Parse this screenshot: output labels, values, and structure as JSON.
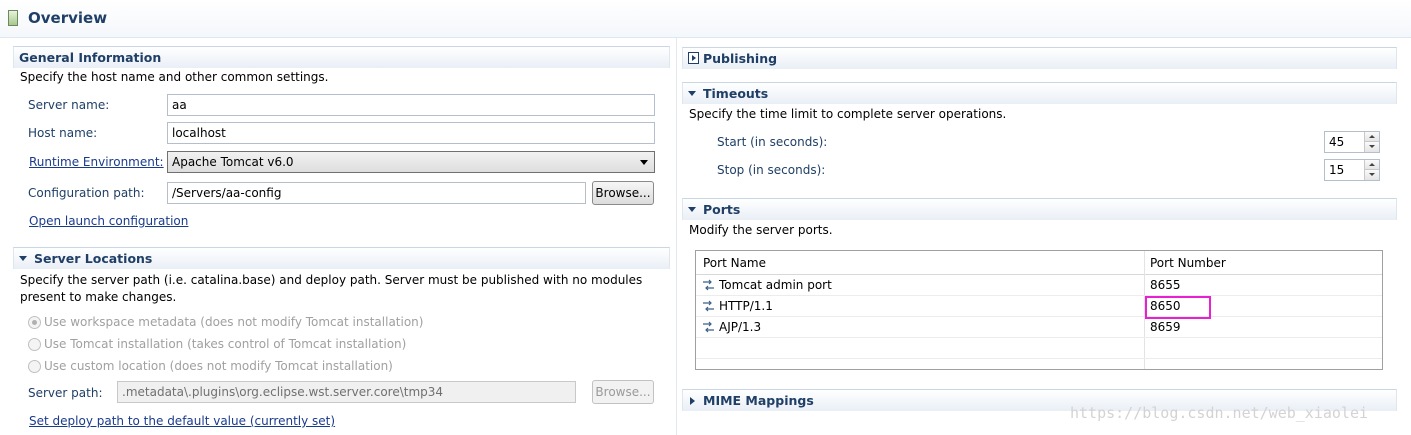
{
  "header": {
    "title": "Overview"
  },
  "general": {
    "title": "General Information",
    "description": "Specify the host name and other common settings.",
    "server_name_label": "Server name:",
    "server_name_value": "aa",
    "host_name_label": "Host name:",
    "host_name_value": "localhost",
    "runtime_label": "Runtime Environment:",
    "runtime_value": "Apache Tomcat v6.0",
    "config_path_label": "Configuration path:",
    "config_path_value": "/Servers/aa-config",
    "browse_label": "Browse...",
    "open_launch_label": "Open launch configuration"
  },
  "locations": {
    "title": "Server Locations",
    "description_line1": "Specify the server path (i.e. catalina.base) and deploy path. Server must be published with no modules",
    "description_line2": "present to make changes.",
    "options": [
      {
        "label": "Use workspace metadata (does not modify Tomcat installation)",
        "checked": true
      },
      {
        "label": "Use Tomcat installation (takes control of Tomcat installation)",
        "checked": false
      },
      {
        "label": "Use custom location (does not modify Tomcat installation)",
        "checked": false
      }
    ],
    "server_path_label": "Server path:",
    "server_path_value": ".metadata\\.plugins\\org.eclipse.wst.server.core\\tmp34",
    "browse_label": "Browse...",
    "deploy_link": "Set deploy path to the default value (currently set)"
  },
  "publishing": {
    "title": "Publishing"
  },
  "timeouts": {
    "title": "Timeouts",
    "description": "Specify the time limit to complete server operations.",
    "start_label": "Start (in seconds):",
    "start_value": "45",
    "stop_label": "Stop (in seconds):",
    "stop_value": "15"
  },
  "ports": {
    "title": "Ports",
    "description": "Modify the server ports.",
    "columns": [
      "Port Name",
      "Port Number"
    ],
    "rows": [
      {
        "name": "Tomcat admin port",
        "port": "8655"
      },
      {
        "name": "HTTP/1.1",
        "port": "8650"
      },
      {
        "name": "AJP/1.3",
        "port": "8659"
      }
    ]
  },
  "mime": {
    "title": "MIME Mappings"
  },
  "watermark": "https://blog.csdn.net/web_xiaolei",
  "colors": {
    "section_title": "#1f3f66",
    "label": "#1f3f66",
    "highlight": "#e81fd2"
  }
}
